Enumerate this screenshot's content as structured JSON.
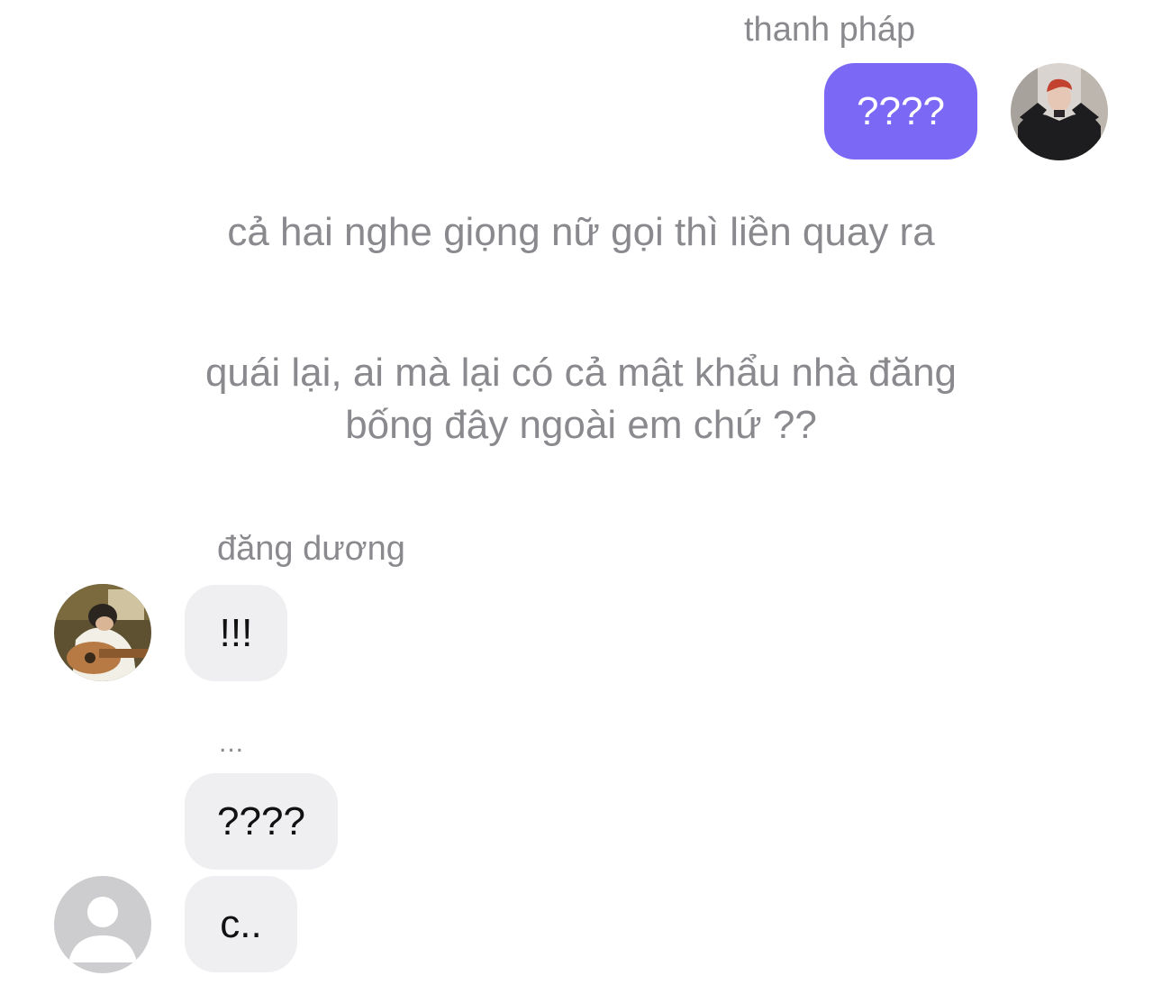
{
  "messages": {
    "thanh_phap": {
      "sender_name": "thanh pháp",
      "text": "????"
    },
    "narration_1": "cả hai nghe giọng nữ gọi thì liền quay ra",
    "narration_2_line1": "quái lại, ai mà lại có cả mật khẩu nhà đăng",
    "narration_2_line2": "bống đây ngoài em chứ ??",
    "dang_duong": {
      "sender_name": "đăng dương",
      "text_1": "!!!",
      "typing": "...",
      "text_2": "????"
    },
    "unknown": {
      "text": "c.."
    }
  },
  "colors": {
    "outgoing_bubble": "#7b68f5",
    "incoming_bubble": "#efeff2",
    "secondary_text": "#8a8a8e"
  },
  "icons": {
    "default_avatar": "person-silhouette-icon"
  }
}
